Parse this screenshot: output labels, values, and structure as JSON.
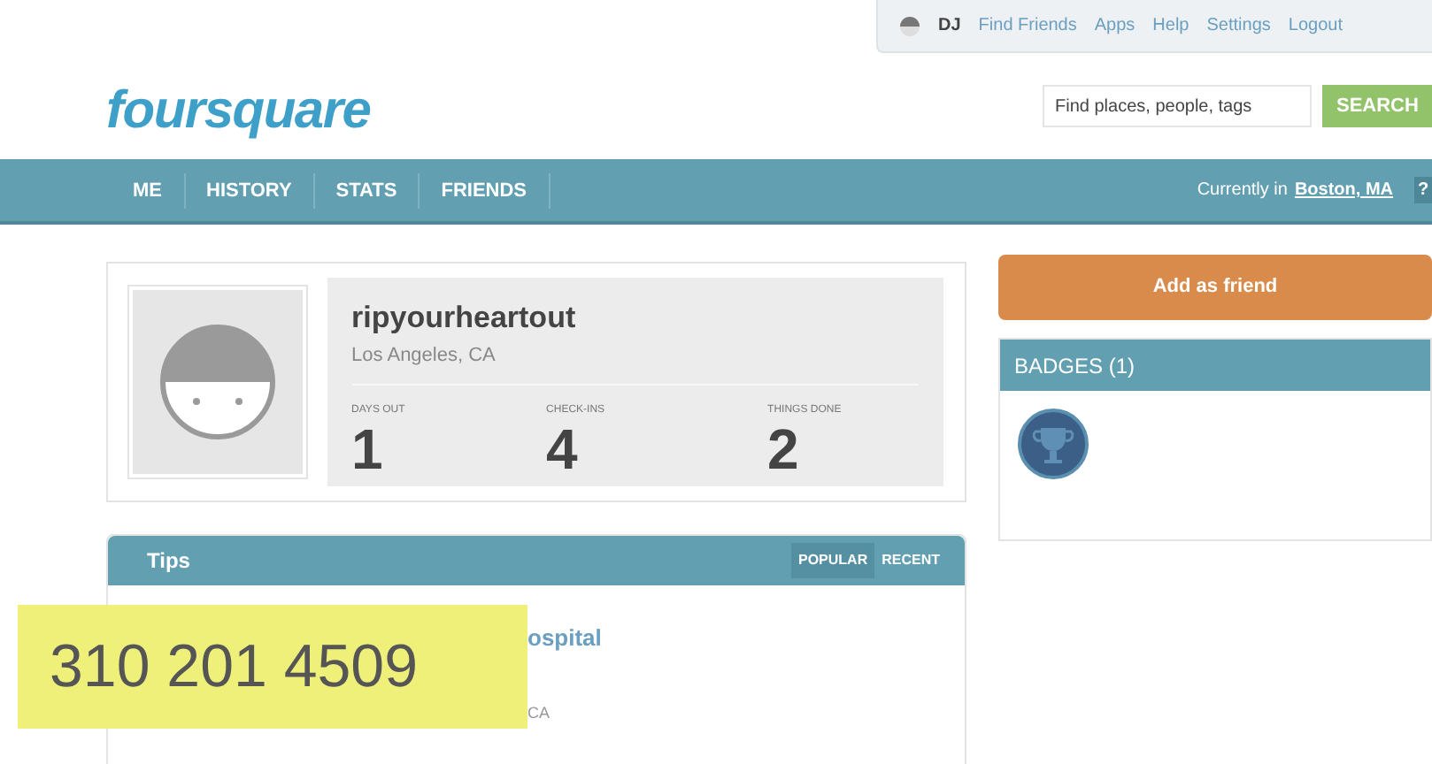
{
  "top_bar": {
    "user": "DJ",
    "links": [
      "Find Friends",
      "Apps",
      "Help",
      "Settings",
      "Logout"
    ]
  },
  "logo": "foursquare",
  "search": {
    "placeholder": "Find places, people, tags",
    "button": "SEARCH"
  },
  "nav": {
    "items": [
      "ME",
      "HISTORY",
      "STATS",
      "FRIENDS"
    ],
    "location_prefix": "Currently in",
    "location": "Boston, MA",
    "help": "?"
  },
  "profile": {
    "name": "ripyourheartout",
    "city": "Los Angeles, CA",
    "stats": [
      {
        "label": "DAYS OUT",
        "value": "1"
      },
      {
        "label": "CHECK-INS",
        "value": "4"
      },
      {
        "label": "THINGS DONE",
        "value": "2"
      }
    ]
  },
  "add_friend": "Add as friend",
  "badges": {
    "title": "BADGES (1)"
  },
  "tips": {
    "title": "Tips",
    "sorts": [
      {
        "label": "POPULAR",
        "selected": true
      },
      {
        "label": "RECENT",
        "selected": false
      }
    ],
    "item": {
      "name": "ospital",
      "city": "CA"
    }
  },
  "overlay": "310 201 4509"
}
